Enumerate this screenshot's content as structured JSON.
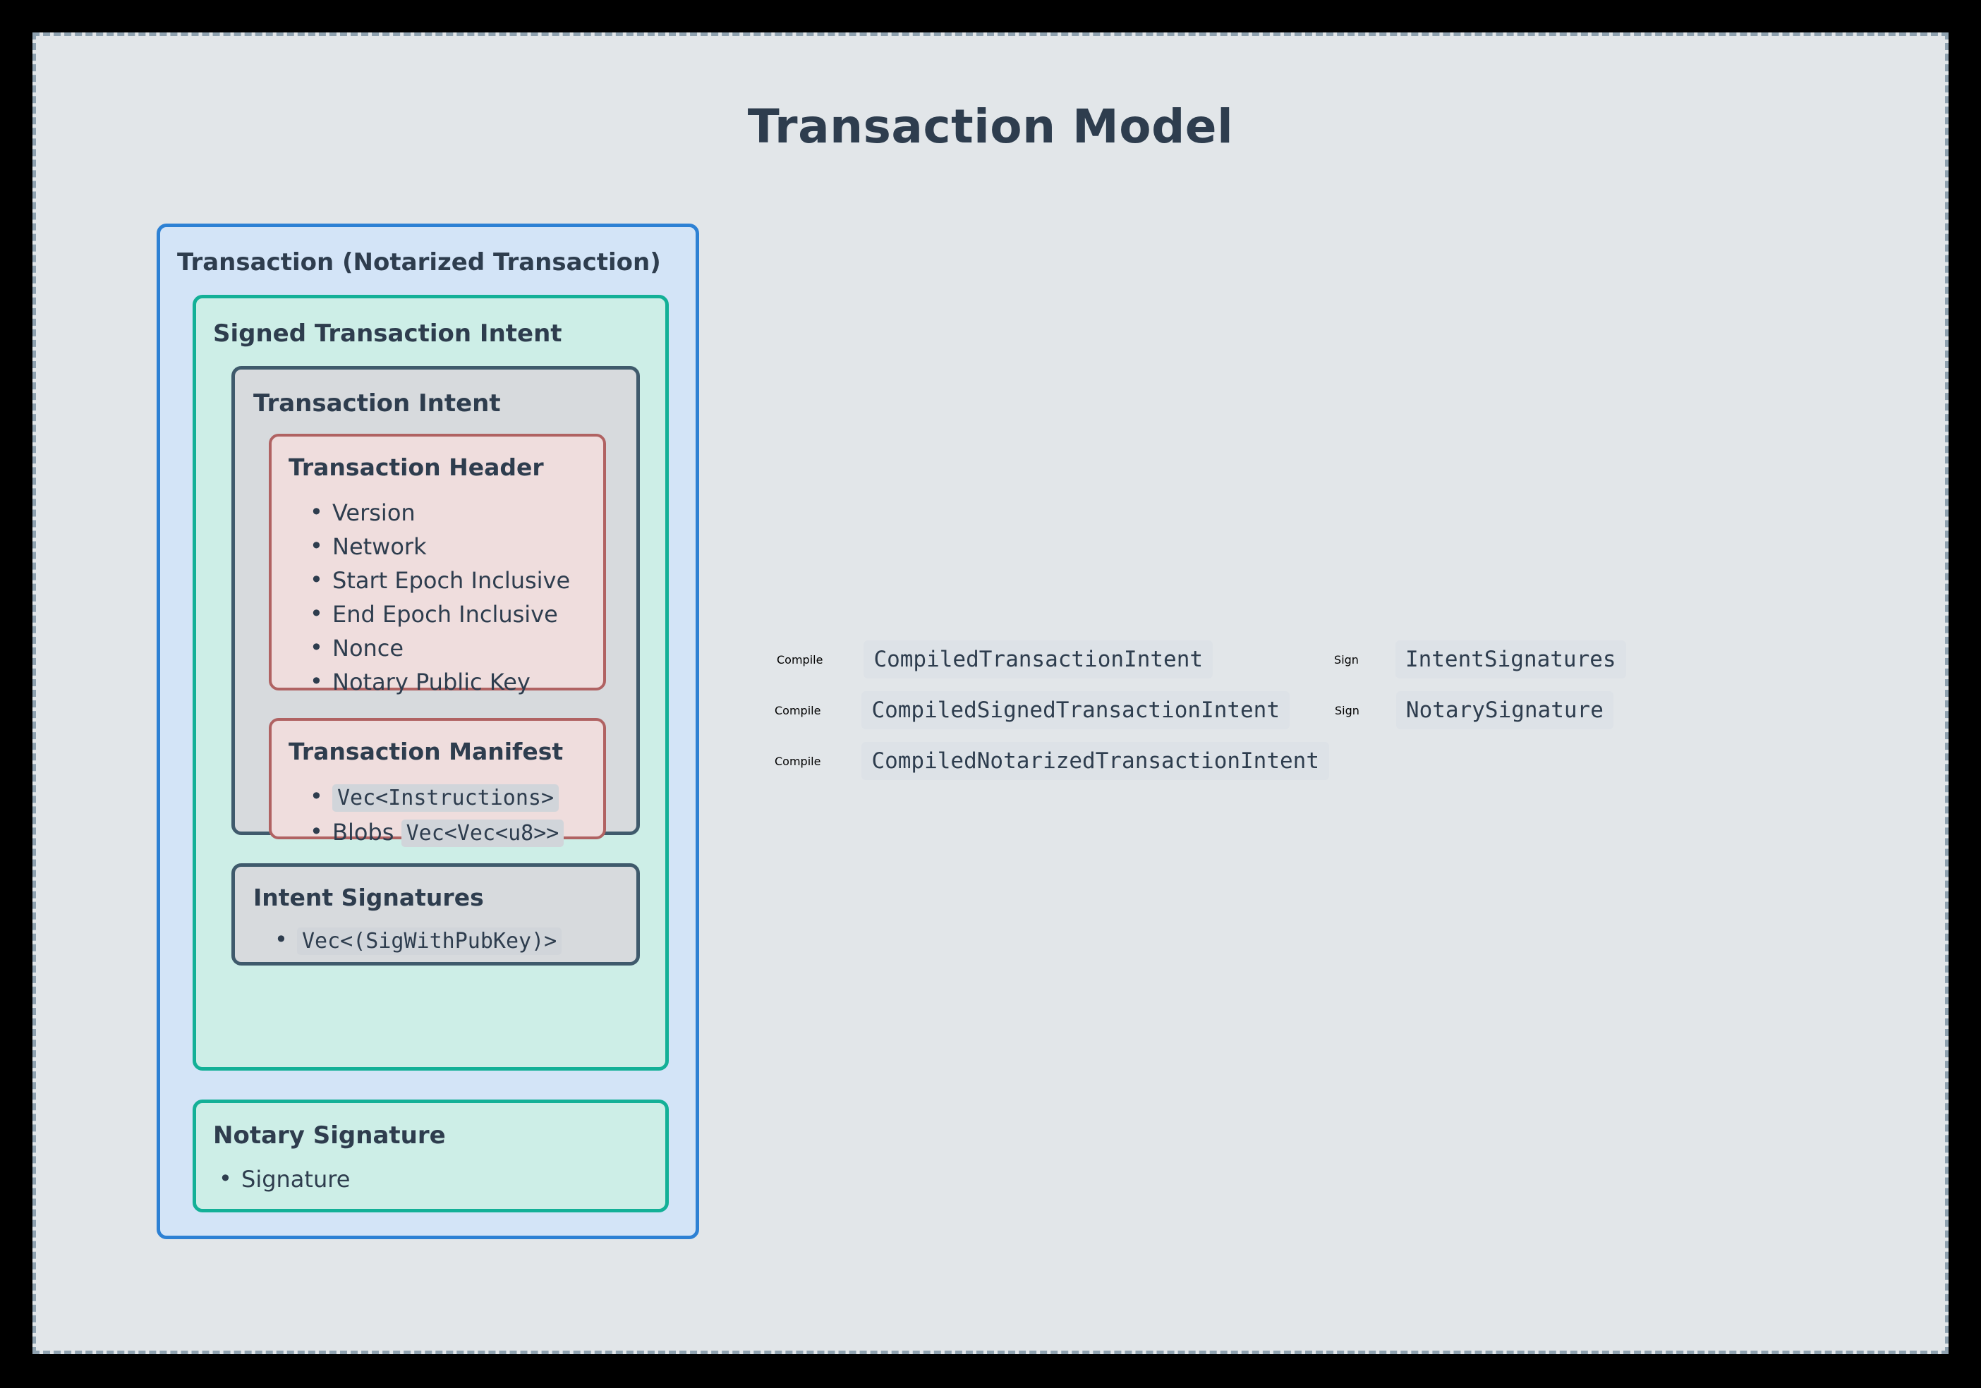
{
  "title": "Transaction Model",
  "colors": {
    "page_bg": "#e2e6e9",
    "frame_border": "#8fa2b0",
    "title_text": "#2e3d4e",
    "transaction_border": "#2d81d4",
    "transaction_fill": "#d3e4f7",
    "signed_intent_border": "#13b097",
    "signed_intent_fill": "#cdeee7",
    "intent_border": "#3f5a6c",
    "intent_fill": "#d7dadd",
    "header_border": "#b06262",
    "header_fill": "#efdddd",
    "arrow": "#6d8194",
    "code_bg": "#d1d5da",
    "node_bg": "#dde2e7"
  },
  "boxes": {
    "transaction": {
      "label": "Transaction (Notarized Transaction)"
    },
    "signed_intent": {
      "label": "Signed Transaction Intent"
    },
    "transaction_intent": {
      "label": "Transaction Intent"
    },
    "transaction_header": {
      "label": "Transaction Header",
      "items": [
        {
          "text": "Version"
        },
        {
          "text": "Network"
        },
        {
          "text": "Start Epoch Inclusive"
        },
        {
          "text": "End Epoch Inclusive"
        },
        {
          "text": "Nonce"
        },
        {
          "text": "Notary Public Key"
        }
      ]
    },
    "transaction_manifest": {
      "label": "Transaction Manifest",
      "items": [
        {
          "text": "",
          "code": "Vec<Instructions>"
        },
        {
          "text": "Blobs",
          "code": "Vec<Vec<u8>>"
        }
      ]
    },
    "intent_signatures": {
      "label": "Intent Signatures",
      "items": [
        {
          "text": "",
          "code": "Vec<(SigWithPubKey)>"
        }
      ]
    },
    "notary_signature": {
      "label": "Notary Signature",
      "items": [
        {
          "text": "Signature"
        }
      ]
    }
  },
  "flows": [
    {
      "source_label": "Compile",
      "node": "CompiledTransactionIntent",
      "second_label": "Sign",
      "second_node": "IntentSignatures"
    },
    {
      "source_label": "Compile",
      "node": "CompiledSignedTransactionIntent",
      "second_label": "Sign",
      "second_node": "NotarySignature"
    },
    {
      "source_label": "Compile",
      "node": "CompiledNotarizedTransactionIntent",
      "second_label": "",
      "second_node": ""
    }
  ]
}
